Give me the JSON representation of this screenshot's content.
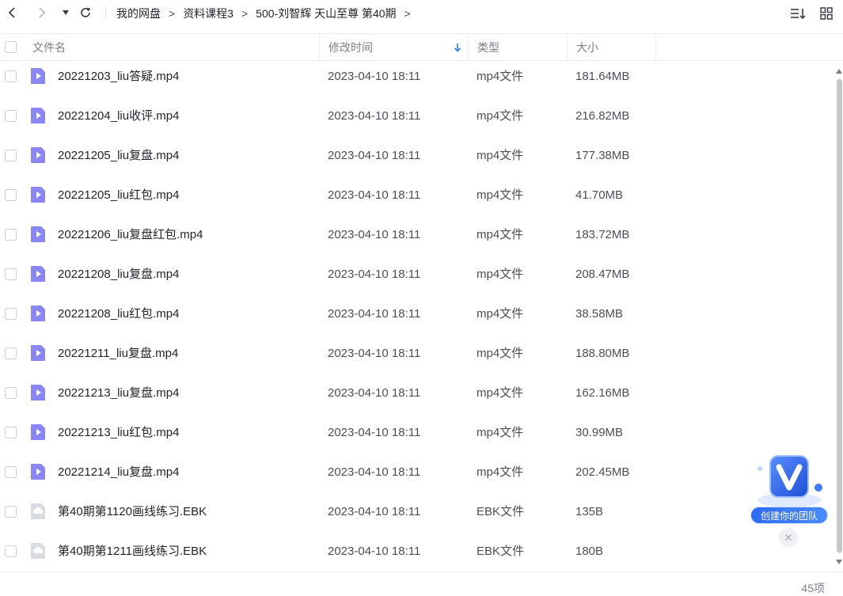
{
  "nav": {
    "back_icon": "chevron-left-icon",
    "forward_icon": "chevron-right-icon",
    "history_icon": "caret-down-icon",
    "refresh_icon": "refresh-icon",
    "breadcrumb": [
      "我的网盘",
      "资料课程3",
      "500-刘智辉 天山至尊 第40期"
    ],
    "separator": ">",
    "sort_icon": "sort-list-icon",
    "grid_icon": "grid-view-icon"
  },
  "header": {
    "name": "文件名",
    "time": "修改时间",
    "type": "类型",
    "size": "大小"
  },
  "files": [
    {
      "name": "20221203_liu答疑.mp4",
      "time": "2023-04-10 18:11",
      "type": "mp4文件",
      "size": "181.64MB",
      "icon": "video-file-icon"
    },
    {
      "name": "20221204_liu收评.mp4",
      "time": "2023-04-10 18:11",
      "type": "mp4文件",
      "size": "216.82MB",
      "icon": "video-file-icon"
    },
    {
      "name": "20221205_liu复盘.mp4",
      "time": "2023-04-10 18:11",
      "type": "mp4文件",
      "size": "177.38MB",
      "icon": "video-file-icon"
    },
    {
      "name": "20221205_liu红包.mp4",
      "time": "2023-04-10 18:11",
      "type": "mp4文件",
      "size": "41.70MB",
      "icon": "video-file-icon"
    },
    {
      "name": "20221206_liu复盘红包.mp4",
      "time": "2023-04-10 18:11",
      "type": "mp4文件",
      "size": "183.72MB",
      "icon": "video-file-icon"
    },
    {
      "name": "20221208_liu复盘.mp4",
      "time": "2023-04-10 18:11",
      "type": "mp4文件",
      "size": "208.47MB",
      "icon": "video-file-icon"
    },
    {
      "name": "20221208_liu红包.mp4",
      "time": "2023-04-10 18:11",
      "type": "mp4文件",
      "size": "38.58MB",
      "icon": "video-file-icon"
    },
    {
      "name": "20221211_liu复盘.mp4",
      "time": "2023-04-10 18:11",
      "type": "mp4文件",
      "size": "188.80MB",
      "icon": "video-file-icon"
    },
    {
      "name": "20221213_liu复盘.mp4",
      "time": "2023-04-10 18:11",
      "type": "mp4文件",
      "size": "162.16MB",
      "icon": "video-file-icon"
    },
    {
      "name": "20221213_liu红包.mp4",
      "time": "2023-04-10 18:11",
      "type": "mp4文件",
      "size": "30.99MB",
      "icon": "video-file-icon"
    },
    {
      "name": "20221214_liu复盘.mp4",
      "time": "2023-04-10 18:11",
      "type": "mp4文件",
      "size": "202.45MB",
      "icon": "video-file-icon"
    },
    {
      "name": "第40期第1120画线练习.EBK",
      "time": "2023-04-10 18:11",
      "type": "EBK文件",
      "size": "135B",
      "icon": "generic-file-icon"
    },
    {
      "name": "第40期第1211画线练习.EBK",
      "time": "2023-04-10 18:11",
      "type": "EBK文件",
      "size": "180B",
      "icon": "generic-file-icon"
    }
  ],
  "promo": {
    "label": "创建你的团队",
    "icon": "v-logo-icon",
    "close_icon": "close-icon"
  },
  "footer": {
    "count": "45项"
  },
  "colors": {
    "video_icon": "#8a86f5",
    "generic_icon": "#d9dce1",
    "accent": "#2e7cf6"
  }
}
